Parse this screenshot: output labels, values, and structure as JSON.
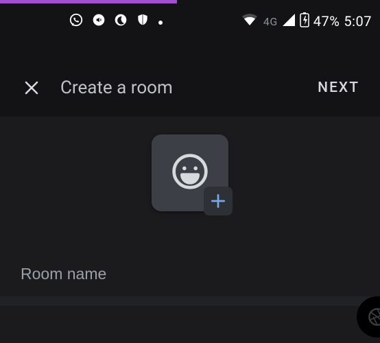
{
  "status": {
    "network_label": "4G",
    "battery_text": "47%",
    "time": "5:07"
  },
  "appbar": {
    "title": "Create a room",
    "next_label": "NEXT"
  },
  "form": {
    "room_name_value": "",
    "room_name_placeholder": "Room name"
  }
}
